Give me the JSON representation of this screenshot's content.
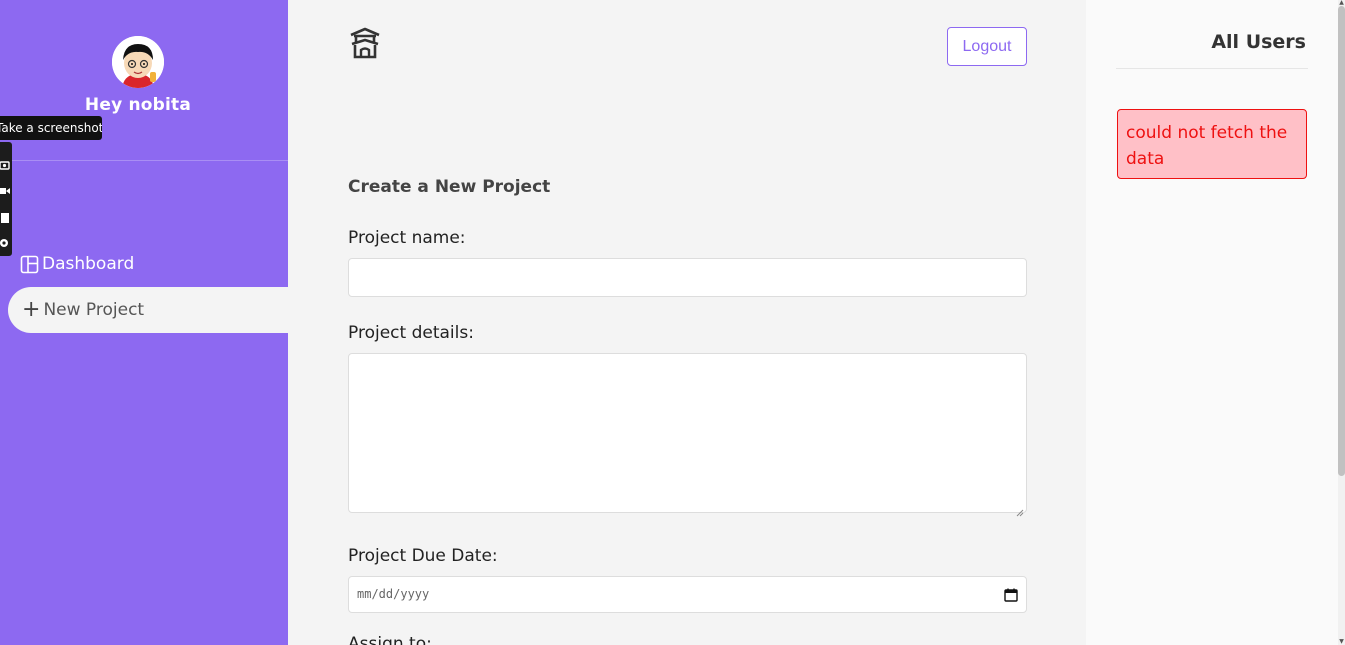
{
  "sidebar": {
    "greeting": "Hey nobita",
    "nav": {
      "dashboard": "Dashboard",
      "new_project": "New Project"
    }
  },
  "extension": {
    "tooltip": "Take a screenshot"
  },
  "header": {
    "logout_label": "Logout"
  },
  "form": {
    "title": "Create a New Project",
    "name_label": "Project name:",
    "details_label": "Project details:",
    "due_label": "Project Due Date:",
    "date_placeholder": "mm/dd/yyyy",
    "next_label": "Assign to:"
  },
  "users_panel": {
    "title": "All Users",
    "error": "could not fetch the data"
  },
  "colors": {
    "accent": "#8d69f1",
    "error": "#ee1111",
    "error_bg": "#ffc0c7"
  }
}
